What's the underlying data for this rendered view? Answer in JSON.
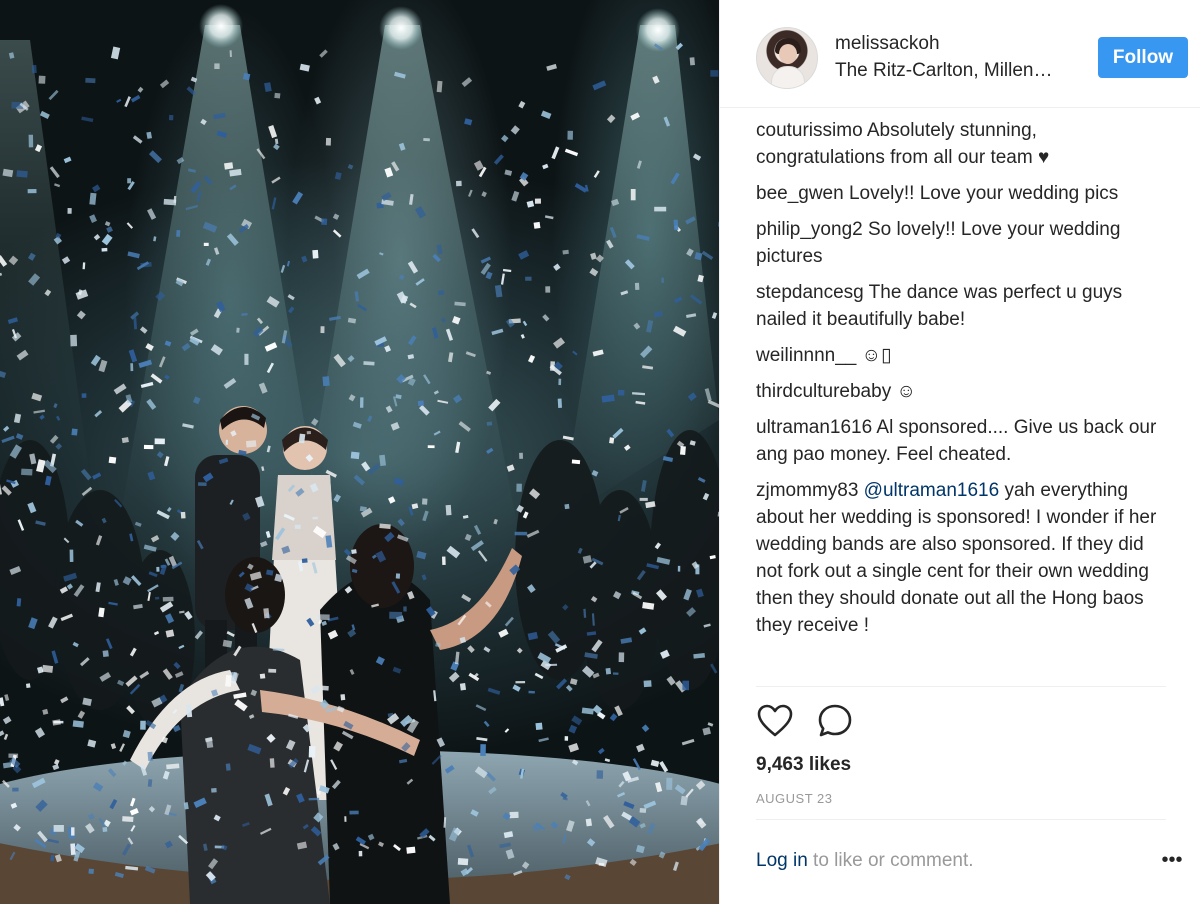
{
  "post": {
    "photo_alt": "wedding photo",
    "username": "melissackoh",
    "location": "The Ritz-Carlton, Millen…",
    "follow_label": "Follow",
    "likes": "9,463 likes",
    "date": "AUGUST 23",
    "login_link": "Log in",
    "login_suffix": " to like or comment.",
    "more_label": "•••"
  },
  "comments": [
    {
      "user": "couturissimo",
      "text": " Absolutely stunning, congratulations from all our team ♥"
    },
    {
      "user": "bee_gwen",
      "text": " Lovely!! Love your wedding pics"
    },
    {
      "user": "philip_yong2",
      "text": " So lovely!! Love your wedding pictures"
    },
    {
      "user": "stepdancesg",
      "text": " The dance was perfect u guys nailed it beautifully babe!"
    },
    {
      "user": "weilinnnn__",
      "text": " ☺▯"
    },
    {
      "user": "thirdculturebaby",
      "text": " ☺"
    },
    {
      "user": "ultraman1616",
      "text": " Al sponsored.... Give us back our ang pao money. Feel cheated."
    },
    {
      "user": "zjmommy83",
      "mention": " @ultraman1616",
      "text": " yah everything about her wedding is sponsored! I wonder if her wedding bands are also sponsored. If they did not fork out a single cent for their own wedding then they should donate out all the Hong baos they receive !"
    }
  ],
  "colors": {
    "follow_button": "#3897f0",
    "link": "#003569",
    "muted_text": "#999999",
    "separator": "#efefef"
  },
  "icons": {
    "like": "heart-outline-icon",
    "comment": "speech-bubble-icon",
    "more": "ellipsis-icon"
  }
}
